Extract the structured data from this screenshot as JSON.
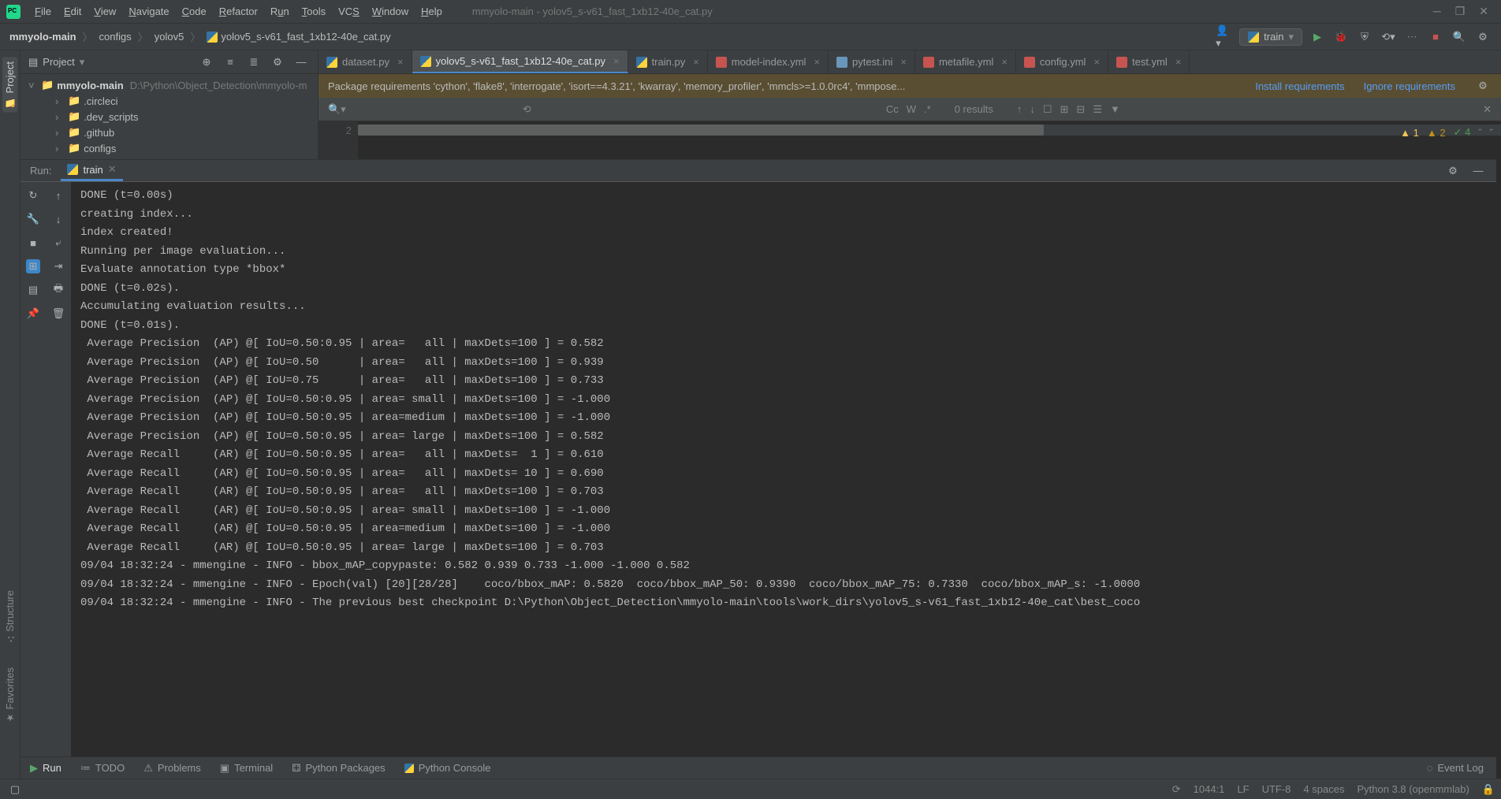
{
  "title": "mmyolo-main - yolov5_s-v61_fast_1xb12-40e_cat.py",
  "menu": [
    "File",
    "Edit",
    "View",
    "Navigate",
    "Code",
    "Refactor",
    "Run",
    "Tools",
    "VCS",
    "Window",
    "Help"
  ],
  "breadcrumb": {
    "root": "mmyolo-main",
    "items": [
      "configs",
      "yolov5"
    ],
    "file": "yolov5_s-v61_fast_1xb12-40e_cat.py"
  },
  "run_config": "train",
  "project_panel": {
    "title": "Project",
    "root": "mmyolo-main",
    "root_path": "D:\\Python\\Object_Detection\\mmyolo-m",
    "children": [
      ".circleci",
      ".dev_scripts",
      ".github",
      "configs"
    ]
  },
  "tabs": [
    {
      "name": "dataset.py",
      "type": "py",
      "active": false
    },
    {
      "name": "yolov5_s-v61_fast_1xb12-40e_cat.py",
      "type": "py",
      "active": true
    },
    {
      "name": "train.py",
      "type": "py",
      "active": false
    },
    {
      "name": "model-index.yml",
      "type": "yml",
      "active": false
    },
    {
      "name": "pytest.ini",
      "type": "ini",
      "active": false
    },
    {
      "name": "metafile.yml",
      "type": "yml",
      "active": false
    },
    {
      "name": "config.yml",
      "type": "yml",
      "active": false
    },
    {
      "name": "test.yml",
      "type": "yml",
      "active": false
    }
  ],
  "warning": {
    "text": "Package requirements 'cython', 'flake8', 'interrogate', 'isort==4.3.21', 'kwarray', 'memory_profiler', 'mmcls>=1.0.0rc4', 'mmpose...",
    "install": "Install requirements",
    "ignore": "Ignore requirements"
  },
  "search": {
    "results": "0 results"
  },
  "editor": {
    "line": "2"
  },
  "inspections": {
    "w1": "1",
    "w2": "2",
    "ok": "4"
  },
  "run_panel": {
    "label": "Run:",
    "tab": "train"
  },
  "console_lines": [
    "DONE (t=0.00s)",
    "creating index...",
    "index created!",
    "Running per image evaluation...",
    "Evaluate annotation type *bbox*",
    "DONE (t=0.02s).",
    "Accumulating evaluation results...",
    "DONE (t=0.01s).",
    " Average Precision  (AP) @[ IoU=0.50:0.95 | area=   all | maxDets=100 ] = 0.582",
    " Average Precision  (AP) @[ IoU=0.50      | area=   all | maxDets=100 ] = 0.939",
    " Average Precision  (AP) @[ IoU=0.75      | area=   all | maxDets=100 ] = 0.733",
    " Average Precision  (AP) @[ IoU=0.50:0.95 | area= small | maxDets=100 ] = -1.000",
    " Average Precision  (AP) @[ IoU=0.50:0.95 | area=medium | maxDets=100 ] = -1.000",
    " Average Precision  (AP) @[ IoU=0.50:0.95 | area= large | maxDets=100 ] = 0.582",
    " Average Recall     (AR) @[ IoU=0.50:0.95 | area=   all | maxDets=  1 ] = 0.610",
    " Average Recall     (AR) @[ IoU=0.50:0.95 | area=   all | maxDets= 10 ] = 0.690",
    " Average Recall     (AR) @[ IoU=0.50:0.95 | area=   all | maxDets=100 ] = 0.703",
    " Average Recall     (AR) @[ IoU=0.50:0.95 | area= small | maxDets=100 ] = -1.000",
    " Average Recall     (AR) @[ IoU=0.50:0.95 | area=medium | maxDets=100 ] = -1.000",
    " Average Recall     (AR) @[ IoU=0.50:0.95 | area= large | maxDets=100 ] = 0.703",
    "09/04 18:32:24 - mmengine - INFO - bbox_mAP_copypaste: 0.582 0.939 0.733 -1.000 -1.000 0.582",
    "09/04 18:32:24 - mmengine - INFO - Epoch(val) [20][28/28]    coco/bbox_mAP: 0.5820  coco/bbox_mAP_50: 0.9390  coco/bbox_mAP_75: 0.7330  coco/bbox_mAP_s: -1.0000",
    "09/04 18:32:24 - mmengine - INFO - The previous best checkpoint D:\\Python\\Object_Detection\\mmyolo-main\\tools\\work_dirs\\yolov5_s-v61_fast_1xb12-40e_cat\\best_coco"
  ],
  "tool_tabs": [
    "Run",
    "TODO",
    "Problems",
    "Terminal",
    "Python Packages",
    "Python Console"
  ],
  "event_log": "Event Log",
  "status": {
    "pos": "1044:1",
    "le": "LF",
    "enc": "UTF-8",
    "indent": "4 spaces",
    "interp": "Python 3.8 (openmmlab)"
  },
  "side_tabs": {
    "project": "Project",
    "structure": "Structure",
    "favorites": "Favorites"
  }
}
